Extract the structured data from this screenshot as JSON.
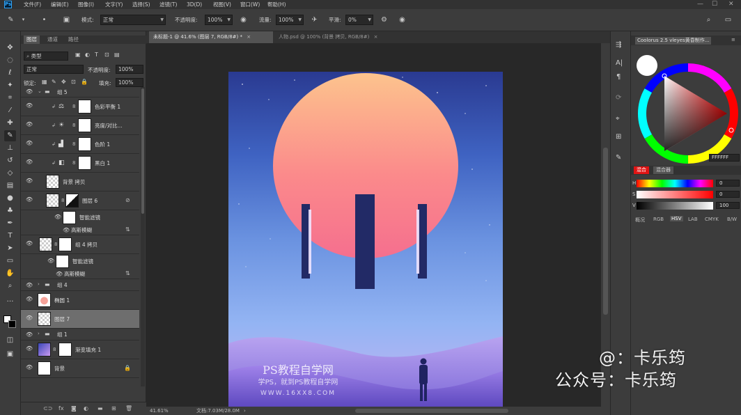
{
  "app": {
    "logo": "Ps"
  },
  "menu": [
    "文件(F)",
    "编辑(E)",
    "图像(I)",
    "文字(Y)",
    "选择(S)",
    "滤镜(T)",
    "3D(D)",
    "视图(V)",
    "窗口(W)",
    "帮助(H)"
  ],
  "options": {
    "mode_label": "模式:",
    "mode_value": "正常",
    "opacity_label": "不透明度:",
    "opacity_value": "100%",
    "flow_label": "流量:",
    "flow_value": "100%",
    "smooth_label": "平滑:",
    "smooth_value": "0%"
  },
  "layers_panel": {
    "tabs": [
      "图层",
      "通道",
      "路径"
    ],
    "kind_filter": "类型",
    "blend_mode": "正常",
    "opacity_label": "不透明度:",
    "opacity_value": "100%",
    "lock_label": "锁定:",
    "fill_label": "填充:",
    "fill_value": "100%",
    "layers": [
      {
        "name": "组 5"
      },
      {
        "name": "色彩平衡 1"
      },
      {
        "name": "亮度/对比..."
      },
      {
        "name": "色阶 1"
      },
      {
        "name": "黑白 1"
      },
      {
        "name": "背景 拷贝"
      },
      {
        "name": "图层 6"
      },
      {
        "name": "智能滤镜"
      },
      {
        "name": "高斯模糊"
      },
      {
        "name": "组 4 拷贝"
      },
      {
        "name": "智能滤镜"
      },
      {
        "name": "高斯模糊"
      },
      {
        "name": "组 4"
      },
      {
        "name": "椭圆 1"
      },
      {
        "name": "图层 7"
      },
      {
        "name": "组 1"
      },
      {
        "name": "渐变填充 1"
      },
      {
        "name": "背景"
      }
    ]
  },
  "doc_tabs": [
    {
      "label": "未标题-1 @ 41.6% (图层 7, RGB/8#) *",
      "active": true
    },
    {
      "label": "人物.psd @ 100% (背景 拷贝, RGB/8#)",
      "active": false
    }
  ],
  "status": {
    "zoom": "41.61%",
    "doc": "文档:7.03M/28.0M"
  },
  "artwork": {
    "watermark_title": "PS教程自学网",
    "watermark_sub": "学PS，就到PS教程自学网",
    "watermark_url": "WWW.16XX8.COM"
  },
  "color_panel": {
    "title": "Coolorus 2.5 vleyes黄昏制作...",
    "hex": "FFFFFF",
    "tabs": [
      "混合",
      "混合器"
    ],
    "slider_values": {
      "h": "0",
      "s": "0",
      "v": "100"
    },
    "slider_labels": {
      "h": "H",
      "s": "S",
      "v": "V"
    },
    "modes": [
      "概况",
      "RGB",
      "HSV",
      "LAB",
      "CMYK",
      "B/W"
    ]
  },
  "overlay": {
    "line1": "@：卡乐筠",
    "line2": "公众号：卡乐筠"
  },
  "colors": {
    "accent": "#31a8ff",
    "panel": "#3c3c3c",
    "canvas_bg": "#282828"
  }
}
